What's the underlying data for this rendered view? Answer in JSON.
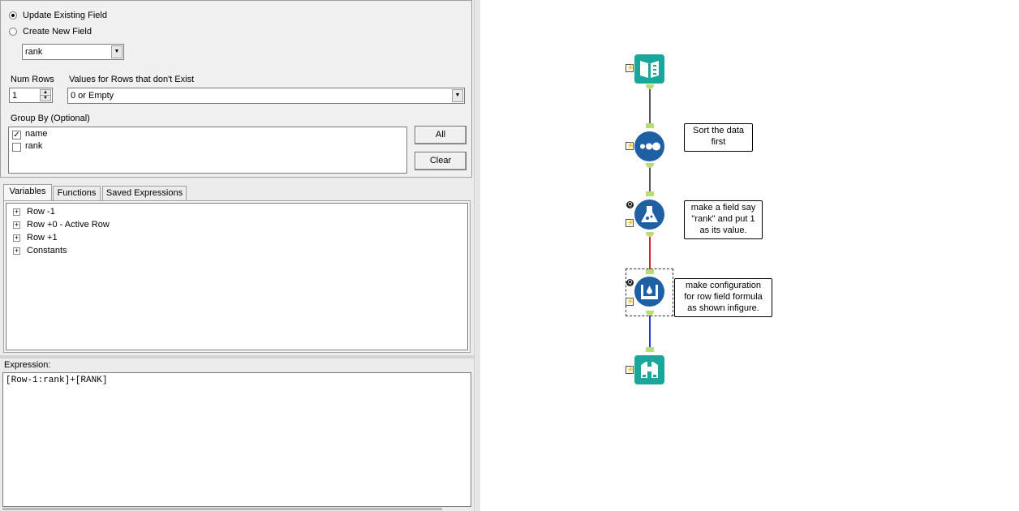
{
  "config": {
    "update_existing_label": "Update Existing Field",
    "create_new_label": "Create New  Field",
    "field_select_value": "rank",
    "num_rows_label": "Num Rows",
    "num_rows_value": "1",
    "values_rows_label": "Values for Rows that don't Exist",
    "values_rows_value": "0 or Empty",
    "group_by_label": "Group By (Optional)",
    "group_by_items": [
      {
        "label": "name",
        "checked": true
      },
      {
        "label": "rank",
        "checked": false
      }
    ],
    "all_button": "All",
    "clear_button": "Clear"
  },
  "tabs": [
    "Variables",
    "Functions",
    "Saved Expressions"
  ],
  "tree": [
    "Row -1",
    "Row +0 - Active Row",
    "Row +1",
    "Constants"
  ],
  "expression": {
    "label": "Expression:",
    "value": "[Row-1:rank]+[RANK]"
  },
  "workflow": {
    "notes": [
      {
        "lines": [
          "Sort the data",
          "first"
        ]
      },
      {
        "lines": [
          "make a field say",
          "\"rank\" and put 1",
          "as its value."
        ]
      },
      {
        "lines": [
          "make configuration",
          "for row field formula",
          "as shown infigure."
        ]
      }
    ],
    "tools": [
      {
        "name": "input-data-tool",
        "icon": "book-icon",
        "color": "#1aa69a"
      },
      {
        "name": "sort-tool",
        "icon": "sort-dots-icon",
        "color": "#1f5fa3"
      },
      {
        "name": "formula-tool",
        "icon": "flask-icon",
        "color": "#1f5fa3"
      },
      {
        "name": "multi-row-formula-tool",
        "icon": "multi-row-icon",
        "color": "#1f5fa3"
      },
      {
        "name": "browse-tool",
        "icon": "binoculars-icon",
        "color": "#1aa69a"
      }
    ],
    "connector_colors": {
      "normal": "#555555",
      "red": "#e02020",
      "blue": "#1a3fd6"
    },
    "anchor_color": "#b8dc78",
    "bolt_symbol": "⚡",
    "q_symbol": "Q"
  }
}
